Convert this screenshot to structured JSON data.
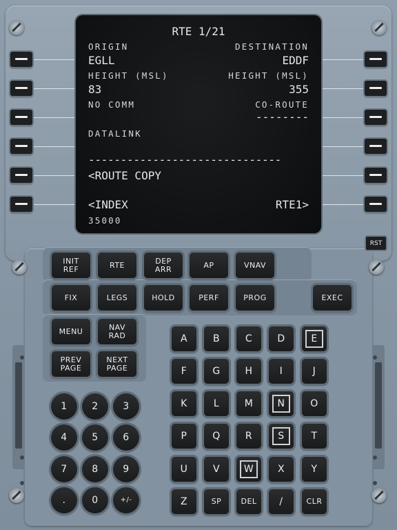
{
  "screen": {
    "title": "RTE 1/21",
    "l1_label": "ORIGIN",
    "l1_value": "EGLL",
    "r1_label": "DESTINATION",
    "r1_value": "EDDF",
    "l2_label": "HEIGHT (MSL)",
    "l2_value": "83",
    "r2_label": "HEIGHT (MSL)",
    "r2_value": "355",
    "l3_label": "NO COMM",
    "r3_label": "CO-ROUTE",
    "r3_value": "--------",
    "l4_label": "DATALINK",
    "separator": "------------------------------",
    "l5_value": "<ROUTE COPY",
    "l6_value": "<INDEX",
    "r6_value": "RTE1>",
    "scratchpad": "35000"
  },
  "rst_label": "RST",
  "function_keys": [
    {
      "label": "INIT\nREF",
      "name": "init-ref"
    },
    {
      "label": "RTE",
      "name": "rte"
    },
    {
      "label": "DEP\nARR",
      "name": "dep-arr"
    },
    {
      "label": "AP",
      "name": "ap"
    },
    {
      "label": "VNAV",
      "name": "vnav"
    },
    {
      "label": "FIX",
      "name": "fix"
    },
    {
      "label": "LEGS",
      "name": "legs"
    },
    {
      "label": "HOLD",
      "name": "hold"
    },
    {
      "label": "PERF",
      "name": "perf"
    },
    {
      "label": "PROG",
      "name": "prog"
    },
    {
      "label": "EXEC",
      "name": "exec"
    },
    {
      "label": "MENU",
      "name": "menu"
    },
    {
      "label": "NAV\nRAD",
      "name": "nav-rad"
    },
    {
      "label": "PREV\nPAGE",
      "name": "prev-page"
    },
    {
      "label": "NEXT\nPAGE",
      "name": "next-page"
    }
  ],
  "alpha_keys": [
    "A",
    "B",
    "C",
    "D",
    "E",
    "F",
    "G",
    "H",
    "I",
    "J",
    "K",
    "L",
    "M",
    "N",
    "O",
    "P",
    "Q",
    "R",
    "S",
    "T",
    "U",
    "V",
    "W",
    "X",
    "Y",
    "Z",
    "SP",
    "DEL",
    "/",
    "CLR"
  ],
  "highlighted_keys": [
    "E",
    "N",
    "S",
    "W"
  ],
  "numeric_keys": [
    "1",
    "2",
    "3",
    "4",
    "5",
    "6",
    "7",
    "8",
    "9",
    ".",
    "0",
    "+/-"
  ]
}
